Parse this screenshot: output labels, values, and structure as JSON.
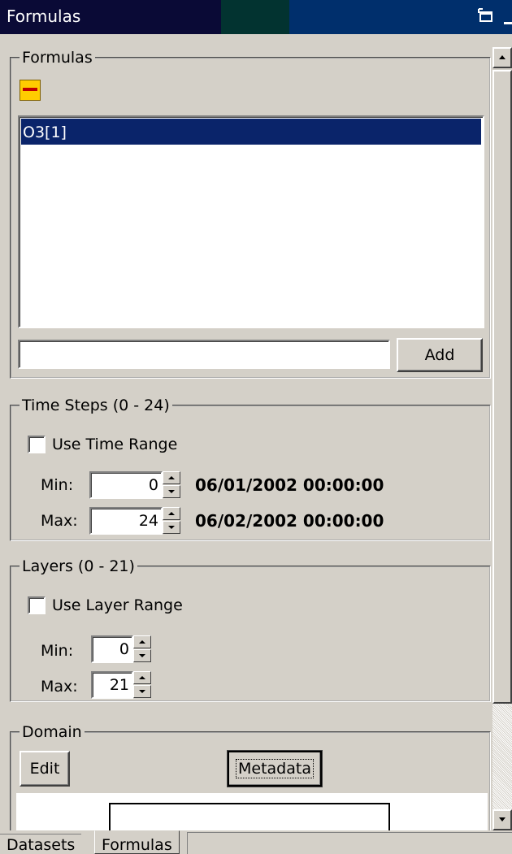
{
  "window": {
    "title": "Formulas"
  },
  "formulas_group": {
    "legend": "Formulas",
    "list_items": [
      "O3[1]"
    ],
    "add_input_value": "",
    "add_label": "Add"
  },
  "time_steps": {
    "legend": "Time Steps (0 - 24)",
    "checkbox_label": "Use Time Range",
    "checked": false,
    "min_label": "Min:",
    "min_value": "0",
    "min_datetime": "06/01/2002 00:00:00",
    "max_label": "Max:",
    "max_value": "24",
    "max_datetime": "06/02/2002 00:00:00"
  },
  "layers": {
    "legend": "Layers (0 - 21)",
    "checkbox_label": "Use Layer Range",
    "checked": false,
    "min_label": "Min:",
    "min_value": "0",
    "max_label": "Max:",
    "max_value": "21"
  },
  "domain": {
    "legend": "Domain",
    "edit_label": "Edit",
    "metadata_label": "Metadata"
  },
  "tabs": [
    "Datasets",
    "Formulas"
  ],
  "active_tab": "Formulas",
  "colors": {
    "selection": "#0a246a",
    "titlebar": "#0a0a36",
    "face": "#d4d0c8"
  }
}
